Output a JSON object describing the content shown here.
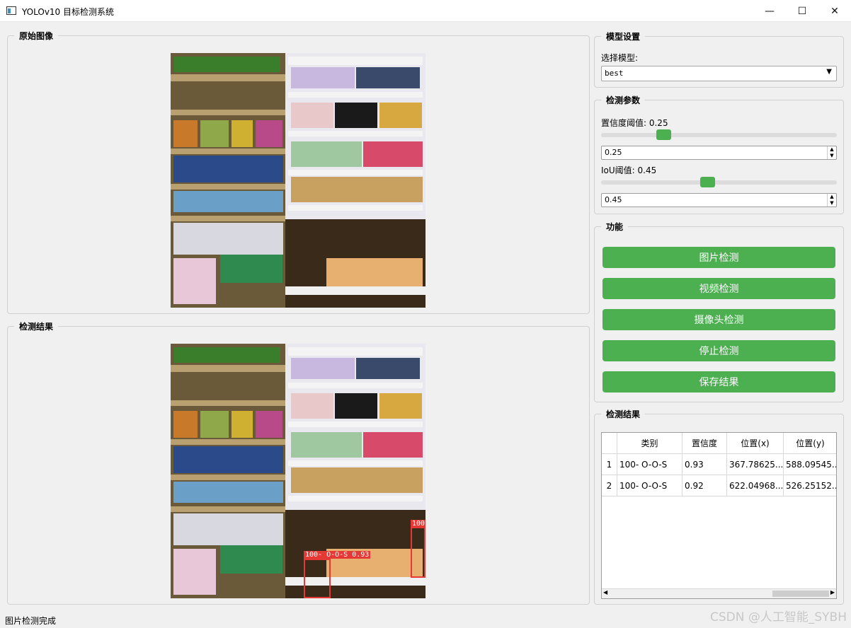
{
  "window": {
    "title": "YOLOv10 目标检测系统",
    "controls": {
      "minimize": "—",
      "maximize": "☐",
      "close": "✕"
    }
  },
  "panels": {
    "original_title": "原始图像",
    "result_title": "检测结果"
  },
  "detections_overlay": [
    {
      "label": "100- O-O-S 0.93"
    },
    {
      "label": "100"
    }
  ],
  "model_settings": {
    "title": "模型设置",
    "select_label": "选择模型:",
    "selected_model": "best"
  },
  "params": {
    "title": "检测参数",
    "confidence_label": "置信度阈值: 0.25",
    "confidence_value": "0.25",
    "confidence_level": 0.25,
    "iou_label": "IoU阈值: 0.45",
    "iou_value": "0.45",
    "iou_level": 0.45
  },
  "functions": {
    "title": "功能",
    "buttons": [
      "图片检测",
      "视频检测",
      "摄像头检测",
      "停止检测",
      "保存结果"
    ]
  },
  "results": {
    "title": "检测结果",
    "columns": [
      "类别",
      "置信度",
      "位置(x)",
      "位置(y)"
    ],
    "rows": [
      {
        "index": "1",
        "cells": [
          "100- O-O-S",
          "0.93",
          "367.78625...",
          "588.09545..."
        ]
      },
      {
        "index": "2",
        "cells": [
          "100- O-O-S",
          "0.92",
          "622.04968...",
          "526.25152..."
        ]
      }
    ]
  },
  "status_text": "图片检测完成",
  "watermark": "CSDN @人工智能_SYBH",
  "icons": [
    "window-app-icon",
    "combo-arrow-icon",
    "spin-arrows-icon"
  ]
}
